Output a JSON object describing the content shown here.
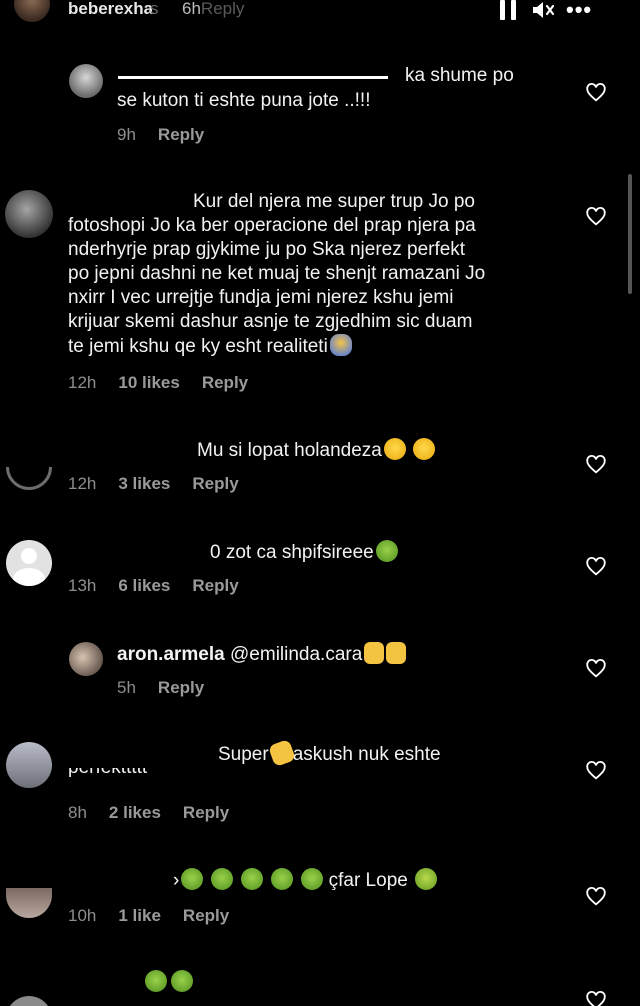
{
  "header": {
    "username": "beberexha",
    "time": "6h",
    "ghost_text": "s",
    "ghost_reply": "Reply"
  },
  "comments": [
    {
      "text": "ka shume po se kuton ti eshte puna jote ..!!!",
      "line1": "ka shume po",
      "line2": "se kuton ti eshte puna jote ..!!!",
      "time": "9h",
      "likes": "",
      "reply": "Reply"
    },
    {
      "lines": [
        "Kur del njera me super trup Jo po",
        "fotoshopi Jo ka ber operacione del prap njera pa",
        "nderhyrje prap gjykime ju po Ska njerez perfekt",
        "po jepni dashni ne ket muaj te shenjt ramazani Jo",
        "nxirr I vec urrejtje fundja jemi njerez kshu jemi",
        "krijuar skemi dashur asnje te zgjedhim sic duam",
        "te jemi kshu qe ky esht realiteti"
      ],
      "time": "12h",
      "likes": "10 likes",
      "reply": "Reply"
    },
    {
      "text": "Mu si lopat holandeza",
      "time": "12h",
      "likes": "3 likes",
      "reply": "Reply"
    },
    {
      "text": "0 zot ca shpifsireee",
      "time": "13h",
      "likes": "6 likes",
      "reply": "Reply"
    },
    {
      "username": "aron.armela",
      "text": "@emilinda.cara",
      "time": "5h",
      "likes": "",
      "reply": "Reply"
    },
    {
      "line1": "Super",
      "line1b": "askush nuk eshte",
      "line2": "perfekttttt",
      "time": "8h",
      "likes": "2 likes",
      "reply": "Reply"
    },
    {
      "text": "çfar Lope",
      "time": "10h",
      "likes": "1 like",
      "reply": "Reply"
    }
  ],
  "icons": {
    "heart": "heart-outline-icon",
    "pause": "pause-icon",
    "mute": "speaker-muted-icon",
    "more": "more-icon"
  },
  "colors": {
    "background": "#000000",
    "text": "#f2f2f2",
    "meta": "#9a9a9a"
  }
}
